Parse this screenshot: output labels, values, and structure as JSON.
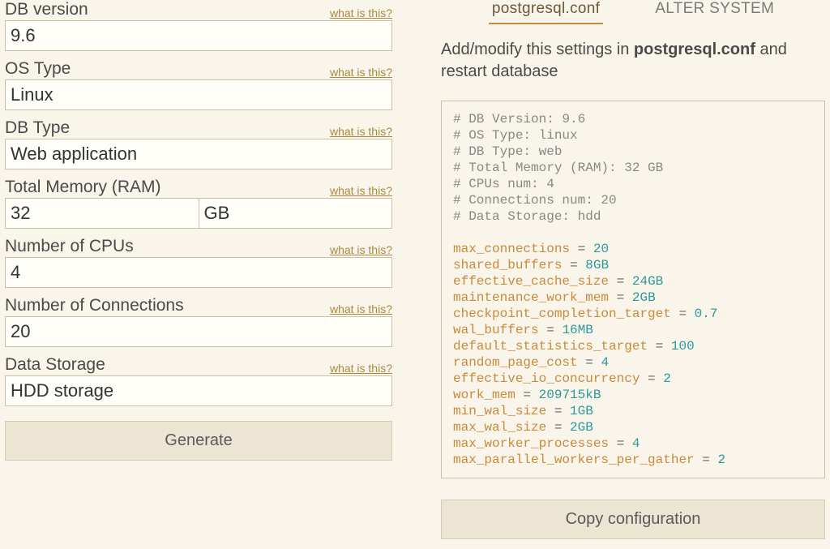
{
  "form": {
    "db_version": {
      "label": "DB version",
      "hint": "what is this?",
      "value": "9.6"
    },
    "os_type": {
      "label": "OS Type",
      "hint": "what is this?",
      "value": "Linux"
    },
    "db_type": {
      "label": "DB Type",
      "hint": "what is this?",
      "value": "Web application"
    },
    "memory": {
      "label": "Total Memory (RAM)",
      "hint": "what is this?",
      "value": "32",
      "unit": "GB"
    },
    "cpus": {
      "label": "Number of CPUs",
      "hint": "what is this?",
      "value": "4"
    },
    "conns": {
      "label": "Number of Connections",
      "hint": "what is this?",
      "value": "20"
    },
    "storage": {
      "label": "Data Storage",
      "hint": "what is this?",
      "value": "HDD storage"
    },
    "generate": "Generate"
  },
  "tabs": {
    "conf": "postgresql.conf",
    "alter": "ALTER SYSTEM"
  },
  "instruction": {
    "pre": "Add/modify this settings in ",
    "bold": "postgresql.conf",
    "post": " and restart database"
  },
  "config": {
    "comments": [
      "# DB Version: 9.6",
      "# OS Type: linux",
      "# DB Type: web",
      "# Total Memory (RAM): 32 GB",
      "# CPUs num: 4",
      "# Connections num: 20",
      "# Data Storage: hdd"
    ],
    "settings": [
      {
        "key": "max_connections",
        "val": "20"
      },
      {
        "key": "shared_buffers",
        "val": "8GB"
      },
      {
        "key": "effective_cache_size",
        "val": "24GB"
      },
      {
        "key": "maintenance_work_mem",
        "val": "2GB"
      },
      {
        "key": "checkpoint_completion_target",
        "val": "0.7"
      },
      {
        "key": "wal_buffers",
        "val": "16MB"
      },
      {
        "key": "default_statistics_target",
        "val": "100"
      },
      {
        "key": "random_page_cost",
        "val": "4"
      },
      {
        "key": "effective_io_concurrency",
        "val": "2"
      },
      {
        "key": "work_mem",
        "val": "209715kB"
      },
      {
        "key": "min_wal_size",
        "val": "1GB"
      },
      {
        "key": "max_wal_size",
        "val": "2GB"
      },
      {
        "key": "max_worker_processes",
        "val": "4"
      },
      {
        "key": "max_parallel_workers_per_gather",
        "val": "2"
      }
    ]
  },
  "copy_btn": "Copy configuration"
}
